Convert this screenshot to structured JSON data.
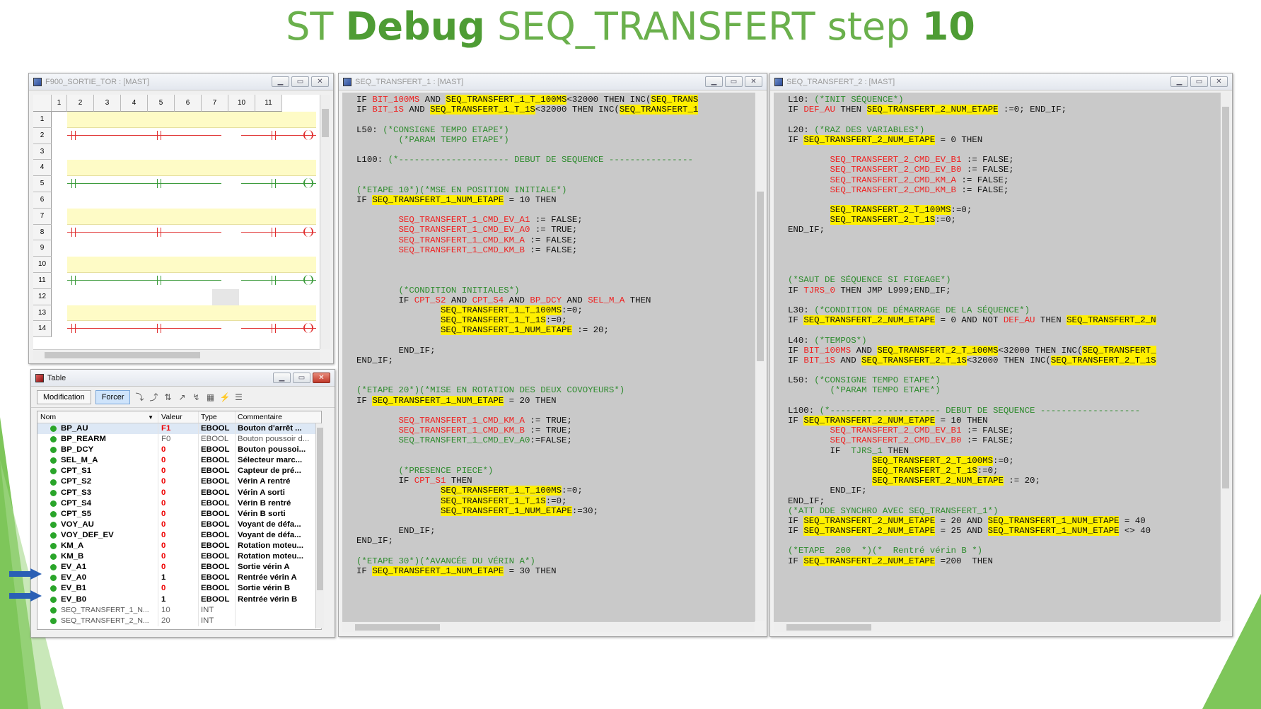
{
  "slide": {
    "title_pre": "ST ",
    "title_bold1": "Debug",
    "title_mid": " SEQ_TRANSFERT step ",
    "title_bold2": "10"
  },
  "colors": {
    "accent_green": "#6ab04c",
    "highlight": "#ffef00",
    "code_bg": "#c9c9c9",
    "comment": "#2e8b2e",
    "red_var": "#e22"
  },
  "ladder_window": {
    "title": "F900_SORTIE_TOR : [MAST]",
    "columns": [
      "1",
      "2",
      "3",
      "4",
      "5",
      "6",
      "7",
      "10",
      "11"
    ],
    "rows": [
      "1",
      "2",
      "3",
      "4",
      "5",
      "6",
      "7",
      "8",
      "9",
      "10",
      "11",
      "12",
      "13",
      "14"
    ]
  },
  "table_window": {
    "title": "Table",
    "toolbar": {
      "modification": "Modification",
      "forcer": "Forcer"
    },
    "headers": {
      "name": "Nom",
      "value": "Valeur",
      "type": "Type",
      "comment": "Commentaire"
    },
    "rows": [
      {
        "name": "BP_AU",
        "value": "F1",
        "type": "EBOOL",
        "comment": "Bouton d'arrêt ..."
      },
      {
        "name": "BP_REARM",
        "value": "F0",
        "type": "EBOOL",
        "comment": "Bouton poussoir d..."
      },
      {
        "name": "BP_DCY",
        "value": "0",
        "type": "EBOOL",
        "comment": "Bouton poussoi..."
      },
      {
        "name": "SEL_M_A",
        "value": "0",
        "type": "EBOOL",
        "comment": "Sélecteur marc..."
      },
      {
        "name": "CPT_S1",
        "value": "0",
        "type": "EBOOL",
        "comment": "Capteur de pré..."
      },
      {
        "name": "CPT_S2",
        "value": "0",
        "type": "EBOOL",
        "comment": "Vérin A rentré"
      },
      {
        "name": "CPT_S3",
        "value": "0",
        "type": "EBOOL",
        "comment": "Vérin A sorti"
      },
      {
        "name": "CPT_S4",
        "value": "0",
        "type": "EBOOL",
        "comment": "Vérin B rentré"
      },
      {
        "name": "CPT_S5",
        "value": "0",
        "type": "EBOOL",
        "comment": "Vérin B sorti"
      },
      {
        "name": "VOY_AU",
        "value": "0",
        "type": "EBOOL",
        "comment": "Voyant de défa..."
      },
      {
        "name": "VOY_DEF_EV",
        "value": "0",
        "type": "EBOOL",
        "comment": "Voyant de défa..."
      },
      {
        "name": "KM_A",
        "value": "0",
        "type": "EBOOL",
        "comment": "Rotation moteu..."
      },
      {
        "name": "KM_B",
        "value": "0",
        "type": "EBOOL",
        "comment": "Rotation moteu..."
      },
      {
        "name": "EV_A1",
        "value": "0",
        "type": "EBOOL",
        "comment": "Sortie vérin A"
      },
      {
        "name": "EV_A0",
        "value": "1",
        "type": "EBOOL",
        "comment": "Rentrée vérin A"
      },
      {
        "name": "EV_B1",
        "value": "0",
        "type": "EBOOL",
        "comment": "Sortie vérin B"
      },
      {
        "name": "EV_B0",
        "value": "1",
        "type": "EBOOL",
        "comment": "Rentrée vérin B"
      },
      {
        "name": "SEQ_TRANSFERT_1_N...",
        "value": "10",
        "type": "INT",
        "comment": ""
      },
      {
        "name": "SEQ_TRANSFERT_2_N...",
        "value": "20",
        "type": "INT",
        "comment": ""
      }
    ]
  },
  "code1_window": {
    "title": "SEQ_TRANSFERT_1 : [MAST]",
    "lines": [
      [
        [
          "k",
          "IF "
        ],
        [
          "r",
          "BIT_100MS"
        ],
        [
          "k",
          " AND "
        ],
        [
          "h",
          "SEQ_TRANSFERT_1_T_100MS"
        ],
        [
          "k",
          "<32000 THEN INC("
        ],
        [
          "h",
          "SEQ_TRANS"
        ]
      ],
      [
        [
          "k",
          "IF "
        ],
        [
          "r",
          "BIT_1S"
        ],
        [
          "k",
          " AND "
        ],
        [
          "h",
          "SEQ_TRANSFERT_1_T_1S"
        ],
        [
          "k",
          "<32000 THEN INC("
        ],
        [
          "h",
          "SEQ_TRANSFERT_1"
        ]
      ],
      [],
      [
        [
          "k",
          "L50: "
        ],
        [
          "c",
          "(*CONSIGNE TEMPO ETAPE*)"
        ]
      ],
      [
        [
          "c",
          "        (*PARAM TEMPO ETAPE*)"
        ]
      ],
      [],
      [
        [
          "k",
          "L100: "
        ],
        [
          "c",
          "(*--------------------- DEBUT DE SEQUENCE ----------------"
        ]
      ],
      [],
      [],
      [
        [
          "c",
          "(*ETAPE 10*)(*MSE EN POSITION INITIALE*)"
        ]
      ],
      [
        [
          "k",
          "IF "
        ],
        [
          "h",
          "SEQ_TRANSFERT_1_NUM_ETAPE"
        ],
        [
          "k",
          " = 10 THEN"
        ]
      ],
      [],
      [
        [
          "k",
          "        "
        ],
        [
          "r",
          "SEQ_TRANSFERT_1_CMD_EV_A1"
        ],
        [
          "k",
          " := FALSE;"
        ]
      ],
      [
        [
          "k",
          "        "
        ],
        [
          "r",
          "SEQ_TRANSFERT_1_CMD_EV_A0"
        ],
        [
          "k",
          " := TRUE;"
        ]
      ],
      [
        [
          "k",
          "        "
        ],
        [
          "r",
          "SEQ_TRANSFERT_1_CMD_KM_A"
        ],
        [
          "k",
          " := FALSE;"
        ]
      ],
      [
        [
          "k",
          "        "
        ],
        [
          "r",
          "SEQ_TRANSFERT_1_CMD_KM_B"
        ],
        [
          "k",
          " := FALSE;"
        ]
      ],
      [],
      [],
      [],
      [
        [
          "k",
          "        "
        ],
        [
          "c",
          "(*CONDITION INITIALES*)"
        ]
      ],
      [
        [
          "k",
          "        IF "
        ],
        [
          "r",
          "CPT_S2"
        ],
        [
          "k",
          " AND "
        ],
        [
          "r",
          "CPT_S4"
        ],
        [
          "k",
          " AND "
        ],
        [
          "r",
          "BP_DCY"
        ],
        [
          "k",
          " AND "
        ],
        [
          "r",
          "SEL_M_A"
        ],
        [
          "k",
          " THEN"
        ]
      ],
      [
        [
          "k",
          "                "
        ],
        [
          "h",
          "SEQ_TRANSFERT_1_T_100MS"
        ],
        [
          "k",
          ":=0;"
        ]
      ],
      [
        [
          "k",
          "                "
        ],
        [
          "h",
          "SEQ_TRANSFERT_1_T_1S"
        ],
        [
          "k",
          ":=0;"
        ]
      ],
      [
        [
          "k",
          "                "
        ],
        [
          "h",
          "SEQ_TRANSFERT_1_NUM_ETAPE"
        ],
        [
          "k",
          " := 20;"
        ]
      ],
      [],
      [
        [
          "k",
          "        END_IF;"
        ]
      ],
      [
        [
          "k",
          "END_IF;"
        ]
      ],
      [],
      [],
      [
        [
          "c",
          "(*ETAPE 20*)(*MISE EN ROTATION DES DEUX COVOYEURS*)"
        ]
      ],
      [
        [
          "k",
          "IF "
        ],
        [
          "h",
          "SEQ_TRANSFERT_1_NUM_ETAPE"
        ],
        [
          "k",
          " = 20 THEN"
        ]
      ],
      [],
      [
        [
          "k",
          "        "
        ],
        [
          "r",
          "SEQ_TRANSFERT_1_CMD_KM_A"
        ],
        [
          "k",
          " := TRUE;"
        ]
      ],
      [
        [
          "k",
          "        "
        ],
        [
          "r",
          "SEQ_TRANSFERT_1_CMD_KM_B"
        ],
        [
          "k",
          " := TRUE;"
        ]
      ],
      [
        [
          "k",
          "        "
        ],
        [
          "c",
          "SEQ_TRANSFERT_1_CMD_EV_A0"
        ],
        [
          "k",
          ":=FALSE;"
        ]
      ],
      [],
      [],
      [
        [
          "k",
          "        "
        ],
        [
          "c",
          "(*PRESENCE PIECE*)"
        ]
      ],
      [
        [
          "k",
          "        IF "
        ],
        [
          "r",
          "CPT_S1"
        ],
        [
          "k",
          " THEN"
        ]
      ],
      [
        [
          "k",
          "                "
        ],
        [
          "h",
          "SEQ_TRANSFERT_1_T_100MS"
        ],
        [
          "k",
          ":=0;"
        ]
      ],
      [
        [
          "k",
          "                "
        ],
        [
          "h",
          "SEQ_TRANSFERT_1_T_1S"
        ],
        [
          "k",
          ":=0;"
        ]
      ],
      [
        [
          "k",
          "                "
        ],
        [
          "h",
          "SEQ_TRANSFERT_1_NUM_ETAPE"
        ],
        [
          "k",
          ":=30;"
        ]
      ],
      [],
      [
        [
          "k",
          "        END_IF;"
        ]
      ],
      [
        [
          "k",
          "END_IF;"
        ]
      ],
      [],
      [
        [
          "c",
          "(*ETAPE 30*)(*AVANCÉE DU VÉRIN A*)"
        ]
      ],
      [
        [
          "k",
          "IF "
        ],
        [
          "h",
          "SEQ_TRANSFERT_1_NUM_ETAPE"
        ],
        [
          "k",
          " = 30 THEN"
        ]
      ]
    ]
  },
  "code2_window": {
    "title": "SEQ_TRANSFERT_2 : [MAST]",
    "lines": [
      [
        [
          "k",
          "L10: "
        ],
        [
          "c",
          "(*INIT SÉQUENCE*)"
        ]
      ],
      [
        [
          "k",
          "IF "
        ],
        [
          "r",
          "DEF_AU"
        ],
        [
          "k",
          " THEN "
        ],
        [
          "h",
          "SEQ_TRANSFERT_2_NUM_ETAPE"
        ],
        [
          "k",
          " :=0; END_IF;"
        ]
      ],
      [],
      [
        [
          "k",
          "L20: "
        ],
        [
          "c",
          "(*RAZ DES VARIABLES*)"
        ]
      ],
      [
        [
          "k",
          "IF "
        ],
        [
          "h",
          "SEQ_TRANSFERT_2_NUM_ETAPE"
        ],
        [
          "k",
          " = 0 THEN"
        ]
      ],
      [],
      [
        [
          "k",
          "        "
        ],
        [
          "r",
          "SEQ_TRANSFERT_2_CMD_EV_B1"
        ],
        [
          "k",
          " := FALSE;"
        ]
      ],
      [
        [
          "k",
          "        "
        ],
        [
          "r",
          "SEQ_TRANSFERT_2_CMD_EV_B0"
        ],
        [
          "k",
          " := FALSE;"
        ]
      ],
      [
        [
          "k",
          "        "
        ],
        [
          "r",
          "SEQ_TRANSFERT_2_CMD_KM_A"
        ],
        [
          "k",
          " := FALSE;"
        ]
      ],
      [
        [
          "k",
          "        "
        ],
        [
          "r",
          "SEQ_TRANSFERT_2_CMD_KM_B"
        ],
        [
          "k",
          " := FALSE;"
        ]
      ],
      [],
      [
        [
          "k",
          "        "
        ],
        [
          "h",
          "SEQ_TRANSFERT_2_T_100MS"
        ],
        [
          "k",
          ":=0;"
        ]
      ],
      [
        [
          "k",
          "        "
        ],
        [
          "h",
          "SEQ_TRANSFERT_2_T_1S"
        ],
        [
          "k",
          ":=0;"
        ]
      ],
      [
        [
          "k",
          "END_IF;"
        ]
      ],
      [],
      [],
      [],
      [],
      [
        [
          "c",
          "(*SAUT DE SÉQUENCE SI FIGEAGE*)"
        ]
      ],
      [
        [
          "k",
          "IF "
        ],
        [
          "r",
          "TJRS_0"
        ],
        [
          "k",
          " THEN JMP L999;END_IF;"
        ]
      ],
      [],
      [
        [
          "k",
          "L30: "
        ],
        [
          "c",
          "(*CONDITION DE DÉMARRAGE DE LA SÉQUENCE*)"
        ]
      ],
      [
        [
          "k",
          "IF "
        ],
        [
          "h",
          "SEQ_TRANSFERT_2_NUM_ETAPE"
        ],
        [
          "k",
          " = 0 AND NOT "
        ],
        [
          "r",
          "DEF_AU"
        ],
        [
          "k",
          " THEN "
        ],
        [
          "h",
          "SEQ_TRANSFERT_2_N"
        ]
      ],
      [],
      [
        [
          "k",
          "L40: "
        ],
        [
          "c",
          "(*TEMPOS*)"
        ]
      ],
      [
        [
          "k",
          "IF "
        ],
        [
          "r",
          "BIT_100MS"
        ],
        [
          "k",
          " AND "
        ],
        [
          "h",
          "SEQ_TRANSFERT_2_T_100MS"
        ],
        [
          "k",
          "<32000 THEN INC("
        ],
        [
          "h",
          "SEQ_TRANSFERT_"
        ]
      ],
      [
        [
          "k",
          "IF "
        ],
        [
          "r",
          "BIT_1S"
        ],
        [
          "k",
          " AND "
        ],
        [
          "h",
          "SEQ_TRANSFERT_2_T_1S"
        ],
        [
          "k",
          "<32000 THEN INC("
        ],
        [
          "h",
          "SEQ_TRANSFERT_2_T_1S"
        ]
      ],
      [],
      [
        [
          "k",
          "L50: "
        ],
        [
          "c",
          "(*CONSIGNE TEMPO ETAPE*)"
        ]
      ],
      [
        [
          "c",
          "        (*PARAM TEMPO ETAPE*)"
        ]
      ],
      [],
      [
        [
          "k",
          "L100: "
        ],
        [
          "c",
          "(*--------------------- DEBUT DE SEQUENCE -------------------"
        ]
      ],
      [
        [
          "k",
          "IF "
        ],
        [
          "h",
          "SEQ_TRANSFERT_2_NUM_ETAPE"
        ],
        [
          "k",
          " = 10 THEN"
        ]
      ],
      [
        [
          "k",
          "        "
        ],
        [
          "r",
          "SEQ_TRANSFERT_2_CMD_EV_B1"
        ],
        [
          "k",
          " := FALSE;"
        ]
      ],
      [
        [
          "k",
          "        "
        ],
        [
          "r",
          "SEQ_TRANSFERT_2_CMD_EV_B0"
        ],
        [
          "k",
          " := FALSE;"
        ]
      ],
      [
        [
          "k",
          "        IF  "
        ],
        [
          "c",
          "TJRS_1"
        ],
        [
          "k",
          " THEN"
        ]
      ],
      [
        [
          "k",
          "                "
        ],
        [
          "h",
          "SEQ_TRANSFERT_2_T_100MS"
        ],
        [
          "k",
          ":=0;"
        ]
      ],
      [
        [
          "k",
          "                "
        ],
        [
          "h",
          "SEQ_TRANSFERT_2_T_1S"
        ],
        [
          "k",
          ":=0;"
        ]
      ],
      [
        [
          "k",
          "                "
        ],
        [
          "h",
          "SEQ_TRANSFERT_2_NUM_ETAPE"
        ],
        [
          "k",
          " := 20;"
        ]
      ],
      [
        [
          "k",
          "        END_IF;"
        ]
      ],
      [
        [
          "k",
          "END_IF;"
        ]
      ],
      [
        [
          "c",
          "(*ATT DDE SYNCHRO AVEC SEQ_TRANSFERT_1*)"
        ]
      ],
      [
        [
          "k",
          "IF "
        ],
        [
          "h",
          "SEQ_TRANSFERT_2_NUM_ETAPE"
        ],
        [
          "k",
          " = 20 AND "
        ],
        [
          "h",
          "SEQ_TRANSFERT_1_NUM_ETAPE"
        ],
        [
          "k",
          " = 40"
        ]
      ],
      [
        [
          "k",
          "IF "
        ],
        [
          "h",
          "SEQ_TRANSFERT_2_NUM_ETAPE"
        ],
        [
          "k",
          " = 25 AND "
        ],
        [
          "h",
          "SEQ_TRANSFERT_1_NUM_ETAPE"
        ],
        [
          "k",
          " <> 40"
        ]
      ],
      [],
      [
        [
          "c",
          "(*ETAPE  200  *)(*  Rentré vérin B *)"
        ]
      ],
      [
        [
          "k",
          "IF "
        ],
        [
          "h",
          "SEQ_TRANSFERT_2_NUM_ETAPE"
        ],
        [
          "k",
          " =200  THEN"
        ]
      ]
    ]
  }
}
